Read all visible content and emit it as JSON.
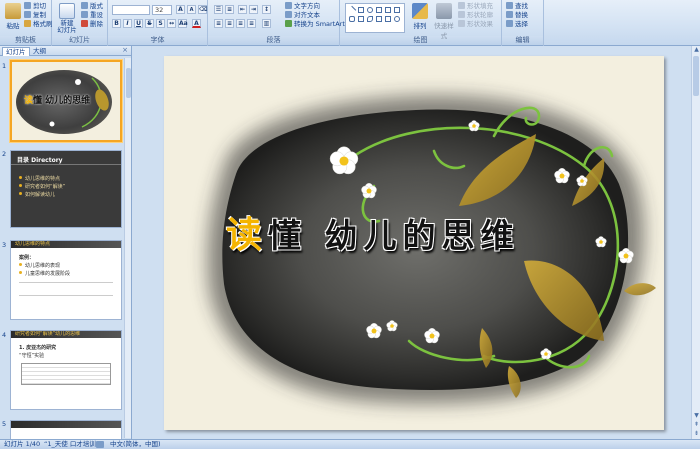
{
  "ribbon": {
    "clipboard": {
      "paste": "粘贴",
      "cut": "剪切",
      "copy": "复制",
      "format_painter": "格式刷",
      "label": "剪贴板"
    },
    "slides": {
      "new_slide": "新建\n幻灯片",
      "layout": "版式",
      "reset": "重设",
      "delete": "删除",
      "label": "幻灯片"
    },
    "font": {
      "size": "32",
      "label": "字体"
    },
    "paragraph": {
      "text_direction": "文字方向",
      "align_text": "对齐文本",
      "smartart": "转换为 SmartArt",
      "label": "段落"
    },
    "drawing": {
      "arrange": "排列",
      "quick_styles": "快速样式",
      "shape_fill": "形状填充",
      "shape_outline": "形状轮廓",
      "shape_effects": "形状效果",
      "label": "绘图"
    },
    "editing": {
      "find": "查找",
      "replace": "替换",
      "select": "选择",
      "label": "编辑"
    }
  },
  "panel": {
    "tab_slides": "幻灯片",
    "tab_outline": "大纲",
    "close": "×",
    "thumbs": [
      {
        "num": "1",
        "title": "读懂 幼儿的思维"
      },
      {
        "num": "2",
        "header": "目录  Directory",
        "items": [
          "幼儿思维的特点",
          "研究者如何“解读”",
          "如何解读幼儿"
        ]
      },
      {
        "num": "3",
        "header": "幼儿思维的特点",
        "heading": "案例：",
        "items": [
          "幼儿思维的表现",
          "儿童思维的发展阶段"
        ]
      },
      {
        "num": "4",
        "header": "研究者如何“解读”幼儿的思维",
        "heading": "1. 皮亚杰的研究",
        "items": [
          "“守恒”实验"
        ]
      },
      {
        "num": "5",
        "header": ""
      }
    ]
  },
  "slide": {
    "title_highlight": "读",
    "title_rest": "懂 幼儿的思维"
  },
  "status": {
    "slide_info": "幻灯片 1/40",
    "theme": "“1_天使 口才培训”",
    "language": "中文(简体，中国)"
  }
}
